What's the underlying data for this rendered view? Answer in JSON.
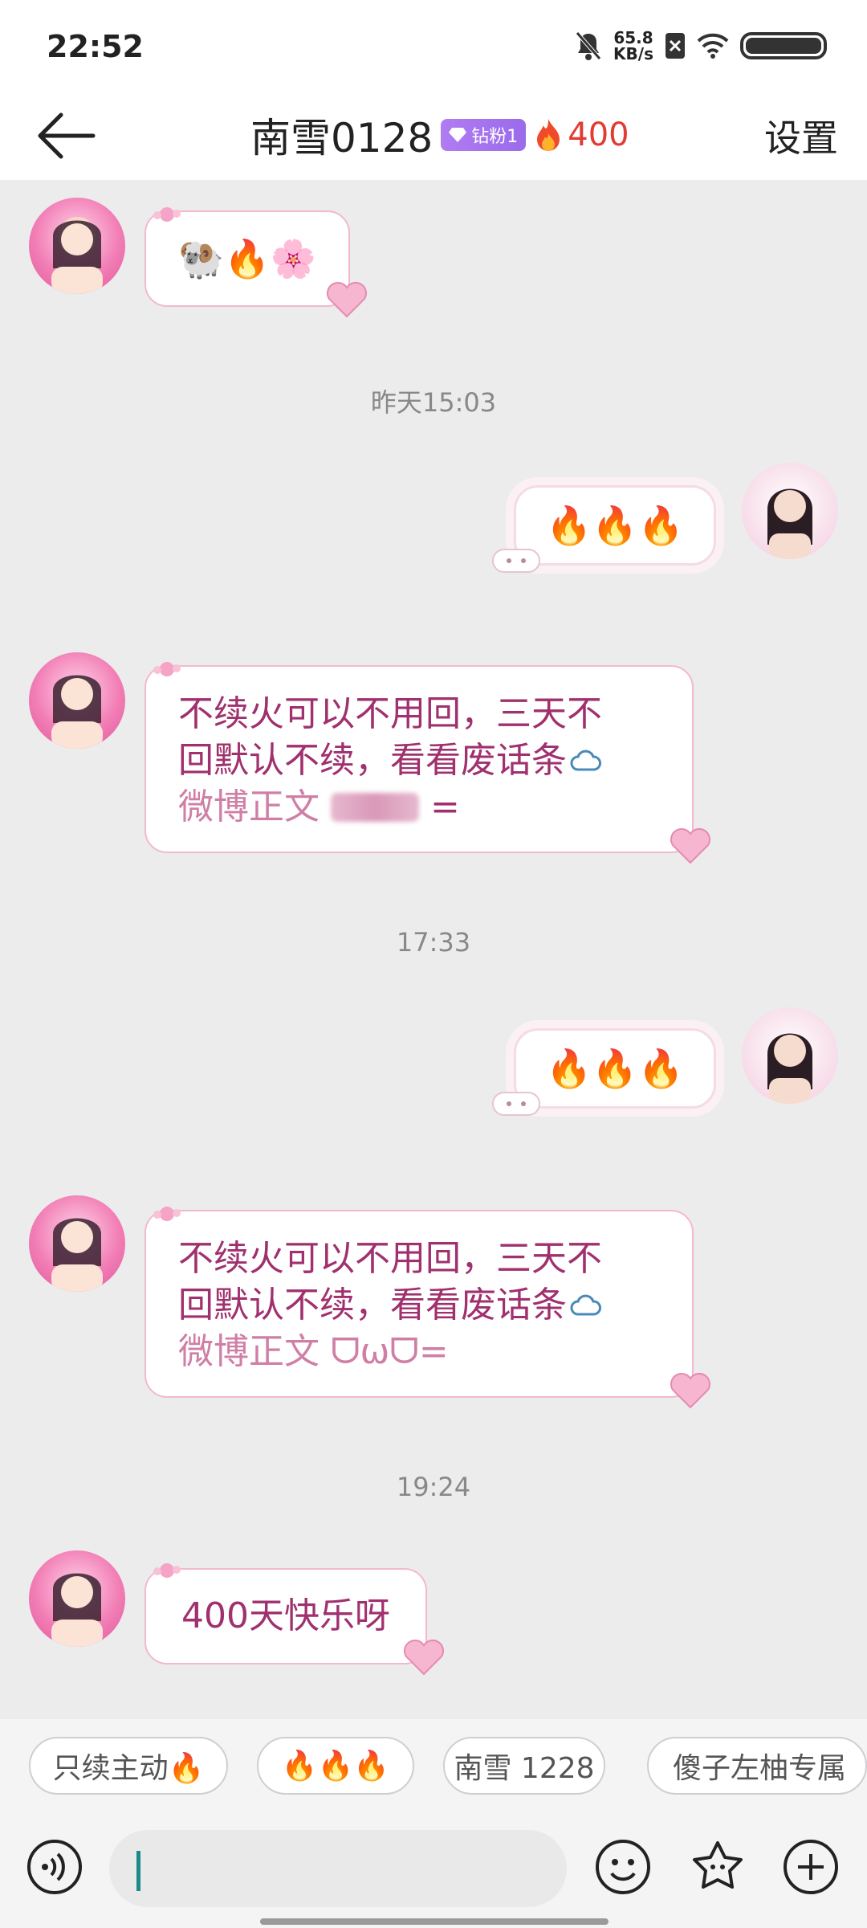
{
  "status_bar": {
    "time": "22:52",
    "speed_value": "65.8",
    "speed_unit": "KB/s"
  },
  "header": {
    "title": "南雪0128",
    "badge": "钻粉1",
    "streak_count": "400",
    "settings_label": "设置"
  },
  "messages": {
    "m1_emojis": "🐏🔥🌸",
    "ts1": "昨天15:03",
    "m2_fires": "🔥🔥🔥",
    "m3_line1": "不续火可以不用回，三天不",
    "m3_line2": "回默认不续，看看废话条",
    "m3_line3": "微博正文",
    "ts2": "17:33",
    "m4_fires": "🔥🔥🔥",
    "m5_line1": "不续火可以不用回，三天不",
    "m5_line2": "回默认不续，看看废话条",
    "m5_line3": "微博正文 ᗜωᗜ=",
    "ts3": "19:24",
    "m6_text": "400天快乐呀"
  },
  "quick_replies": [
    "只续主动🔥",
    "🔥🔥🔥",
    "南雪 1228",
    "傻子左柚专属"
  ],
  "colors": {
    "accent_pink": "#a0306e",
    "streak_red": "#e23b32",
    "badge_purple": "#9a6bea"
  }
}
